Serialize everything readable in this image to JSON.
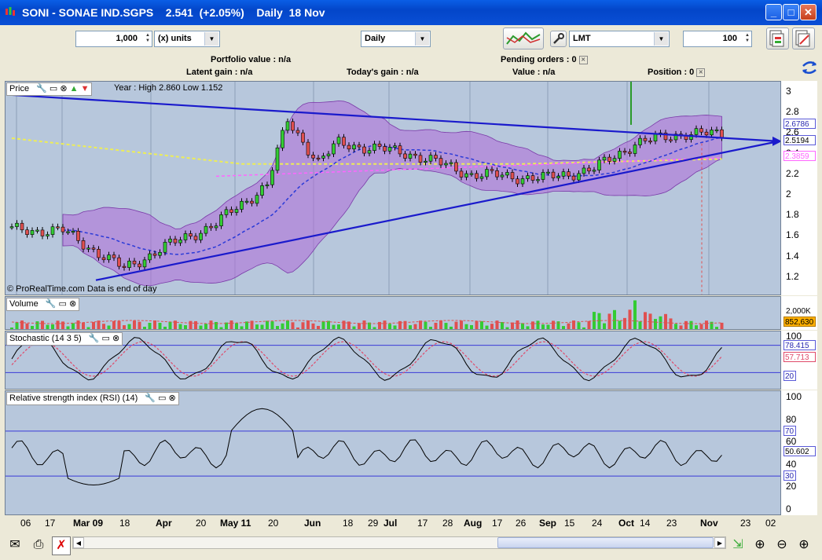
{
  "window": {
    "title": "SONI - SONAE IND.SGPS    2.541  (+2.05%)    Daily  18 Nov",
    "minimize": "_",
    "maximize": "□",
    "close": "✕"
  },
  "toolbar": {
    "quantity_value": "1,000",
    "units_select": "(x) units",
    "period_select": "Daily",
    "order_type_select": "LMT",
    "limit_value": "100"
  },
  "info": {
    "portfolio_value": "Portfolio value : n/a",
    "latent_gain": "Latent gain : n/a",
    "todays_gain": "Today's gain : n/a",
    "pending_orders": "Pending orders : 0",
    "value": "Value : n/a",
    "position": "Position : 0"
  },
  "price_panel": {
    "title": "Price",
    "year_info": "Year : High 2.860 Low 1.152",
    "watermark": "© ProRealTime.com   Data is end of day",
    "ticks": [
      "3",
      "2.8",
      "2.6",
      "2.4",
      "2.2",
      "2",
      "1.8",
      "1.6",
      "1.4",
      "1.2"
    ],
    "labels": [
      "2.6786",
      "2.5194",
      "2.3859"
    ]
  },
  "volume_panel": {
    "title": "Volume",
    "tick": "2,000K",
    "label": "852,630"
  },
  "stochastic_panel": {
    "title": "Stochastic (14 3 5)",
    "ticks": [
      "100",
      "20"
    ],
    "labels": [
      "78.415",
      "57.713"
    ]
  },
  "rsi_panel": {
    "title": "Relative strength index (RSI) (14)",
    "ticks": [
      "100",
      "80",
      "70",
      "60",
      "50",
      "40",
      "30",
      "20",
      "0"
    ],
    "labels": [
      "70",
      "50.602",
      "30"
    ]
  },
  "dates": [
    {
      "t": "06",
      "b": false
    },
    {
      "t": "17",
      "b": false
    },
    {
      "t": "Mar 09",
      "b": true
    },
    {
      "t": "18",
      "b": false
    },
    {
      "t": "Apr",
      "b": true
    },
    {
      "t": "20",
      "b": false
    },
    {
      "t": "May 11",
      "b": true
    },
    {
      "t": "20",
      "b": false
    },
    {
      "t": "Jun",
      "b": true
    },
    {
      "t": "18",
      "b": false
    },
    {
      "t": "29",
      "b": false
    },
    {
      "t": "Jul",
      "b": true
    },
    {
      "t": "17",
      "b": false
    },
    {
      "t": "28",
      "b": false
    },
    {
      "t": "Aug",
      "b": true
    },
    {
      "t": "17",
      "b": false
    },
    {
      "t": "26",
      "b": false
    },
    {
      "t": "Sep",
      "b": true
    },
    {
      "t": "15",
      "b": false
    },
    {
      "t": "24",
      "b": false
    },
    {
      "t": "Oct",
      "b": true
    },
    {
      "t": "14",
      "b": false
    },
    {
      "t": "23",
      "b": false
    },
    {
      "t": "Nov",
      "b": true
    },
    {
      "t": "23",
      "b": false
    },
    {
      "t": "02",
      "b": false
    }
  ],
  "colors": {
    "panel_bg": "#b7c7dc",
    "trendline": "#1a1acc",
    "band_fill": "#b06ad8",
    "ma_yellow": "#eeee55",
    "ma_pink": "#ff66ff",
    "up_candle": "#33cc33",
    "down_candle": "#e05050"
  },
  "icons": {
    "statusbar": [
      "email-icon",
      "print-icon",
      "delete-icon",
      "auto-scroll-icon",
      "zoom-select-icon",
      "zoom-out-icon",
      "zoom-in-icon"
    ]
  }
}
